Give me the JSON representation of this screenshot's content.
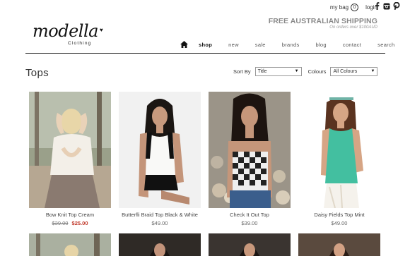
{
  "header": {
    "bag_label": "my bag",
    "bag_count": "0",
    "login_label": "login",
    "shipping_title": "FREE AUSTRALIAN SHIPPING",
    "shipping_sub": "On orders over $100AUD",
    "logo_text": "modella",
    "logo_sub": "Clothing",
    "social": [
      "facebook-icon",
      "instagram-icon",
      "pinterest-icon"
    ]
  },
  "nav": {
    "items": [
      "shop",
      "new",
      "sale",
      "brands",
      "blog",
      "contact",
      "search"
    ],
    "active": "shop"
  },
  "page": {
    "title": "Tops",
    "sort_label": "Sort By",
    "sort_value": "Title",
    "colour_label": "Colours",
    "colour_value": "All Colours"
  },
  "products": [
    {
      "name": "Bow Knit Top Cream",
      "was": "$39.00",
      "price": "$25.00",
      "on_sale": true
    },
    {
      "name": "Butterfli Braid Top Black & White",
      "price": "$49.00",
      "on_sale": false
    },
    {
      "name": "Check It Out Top",
      "price": "$39.00",
      "on_sale": false
    },
    {
      "name": "Daisy Fields Top Mint",
      "price": "$49.00",
      "on_sale": false
    }
  ],
  "colors": {
    "accent_sale": "#c0392b",
    "rule": "#222222"
  }
}
